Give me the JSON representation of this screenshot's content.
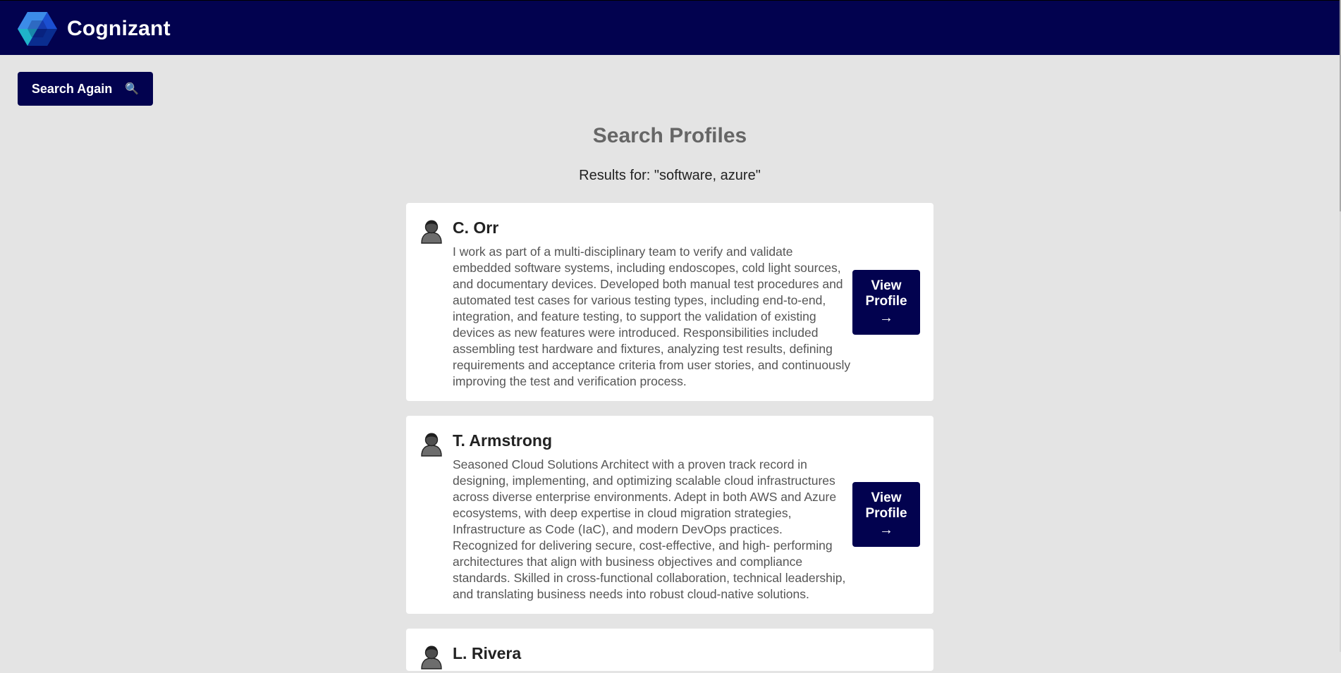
{
  "header": {
    "brand_name": "Cognizant",
    "logo_icon": "cognizant-logo"
  },
  "actions": {
    "search_again_label": "Search Again",
    "search_again_icon": "🔍"
  },
  "page": {
    "title": "Search Profiles",
    "results_text": "Results for: \"software, azure\""
  },
  "profiles": [
    {
      "avatar_icon": "person-icon",
      "name": "C. Orr",
      "summary": "I work as part of a multi-disciplinary team to verify and validate embedded software systems, including endoscopes, cold light sources, and documentary devices. Developed both manual test procedures and automated test cases for various testing types, including end-to-end, integration, and feature testing, to support the validation of existing devices as new features were introduced. Responsibilities included assembling test hardware and fixtures, analyzing test results, defining requirements and acceptance criteria from user stories, and continuously improving the test and verification process.",
      "button_line1": "View",
      "button_line2": "Profile",
      "button_arrow": "→"
    },
    {
      "avatar_icon": "person-icon",
      "name": "T. Armstrong",
      "summary": "Seasoned Cloud Solutions Architect with a proven track record in designing, implementing, and optimizing scalable cloud infrastructures across diverse enterprise environments. Adept in both AWS and Azure ecosystems, with deep expertise in cloud migration strategies, Infrastructure as Code (IaC), and modern DevOps practices. Recognized for delivering secure, cost-effective, and high- performing architectures that align with business objectives and compliance standards. Skilled in cross-functional collaboration, technical leadership, and translating business needs into robust cloud-native solutions.",
      "button_line1": "View",
      "button_line2": "Profile",
      "button_arrow": "→"
    },
    {
      "avatar_icon": "person-icon",
      "name": "L. Rivera"
    }
  ],
  "colors": {
    "navy": "#02024f",
    "background": "#e4e4e4",
    "card": "#ffffff"
  }
}
